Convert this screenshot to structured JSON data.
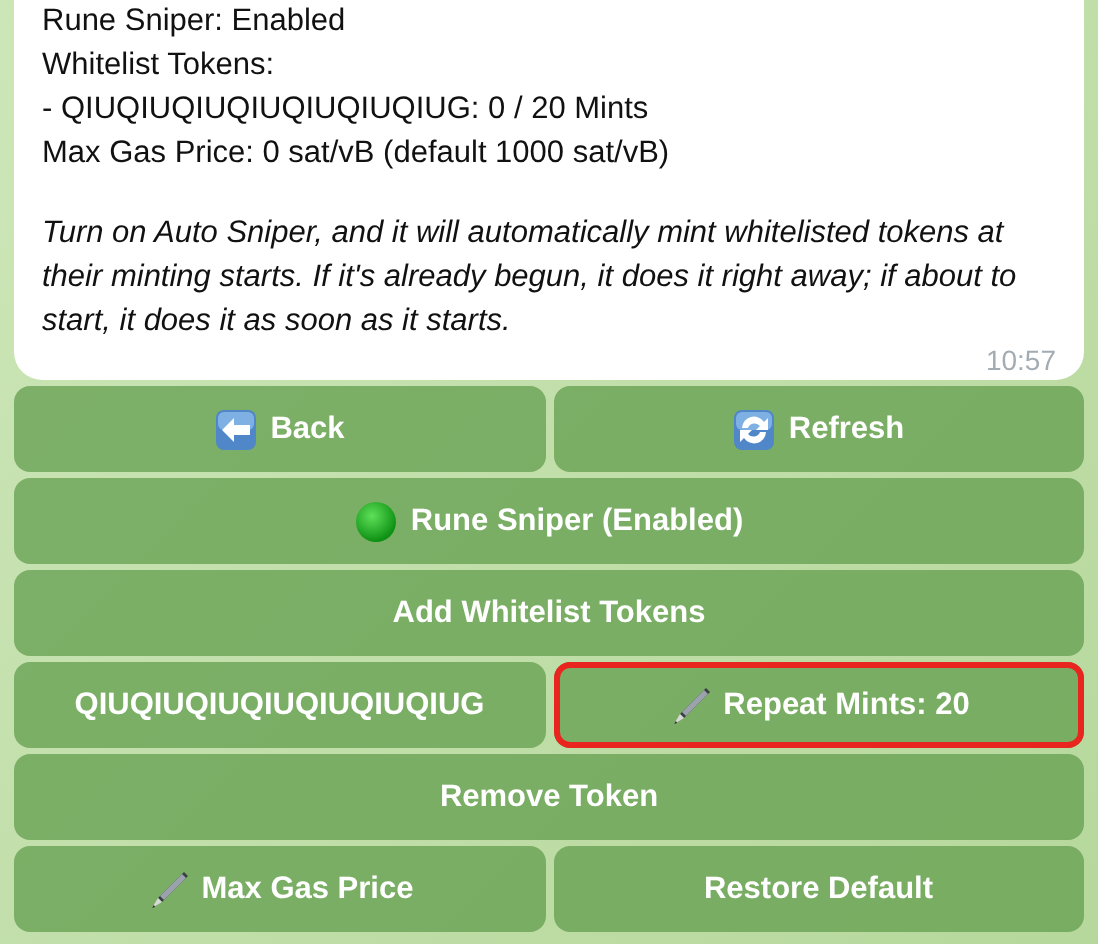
{
  "message": {
    "lines": [
      "Rune Sniper: Enabled",
      "Whitelist Tokens:",
      "- QIUQIUQIUQIUQIUQIUQIUG: 0 / 20 Mints",
      "Max Gas Price: 0 sat/vB (default 1000 sat/vB)"
    ],
    "note": "Turn on Auto Sniper, and it will automatically mint whitelisted tokens at their minting starts. If it's already begun, it does it right away; if about to start, it does it as soon as it starts.",
    "time": "10:57"
  },
  "keyboard": [
    [
      {
        "kind": "back",
        "label": "Back",
        "highlighted": false
      },
      {
        "kind": "refresh",
        "label": "Refresh",
        "highlighted": false
      }
    ],
    [
      {
        "kind": "status",
        "label": "Rune Sniper (Enabled)",
        "highlighted": false
      }
    ],
    [
      {
        "kind": "plain",
        "label": "Add Whitelist Tokens",
        "highlighted": false
      }
    ],
    [
      {
        "kind": "plain",
        "label": "QIUQIUQIUQIUQIUQIUQIUG",
        "highlighted": false
      },
      {
        "kind": "edit",
        "label": "Repeat Mints: 20",
        "highlighted": true
      }
    ],
    [
      {
        "kind": "plain",
        "label": "Remove Token",
        "highlighted": false
      }
    ],
    [
      {
        "kind": "edit",
        "label": "Max Gas Price",
        "highlighted": false
      },
      {
        "kind": "plain",
        "label": "Restore Default",
        "highlighted": false
      }
    ]
  ]
}
